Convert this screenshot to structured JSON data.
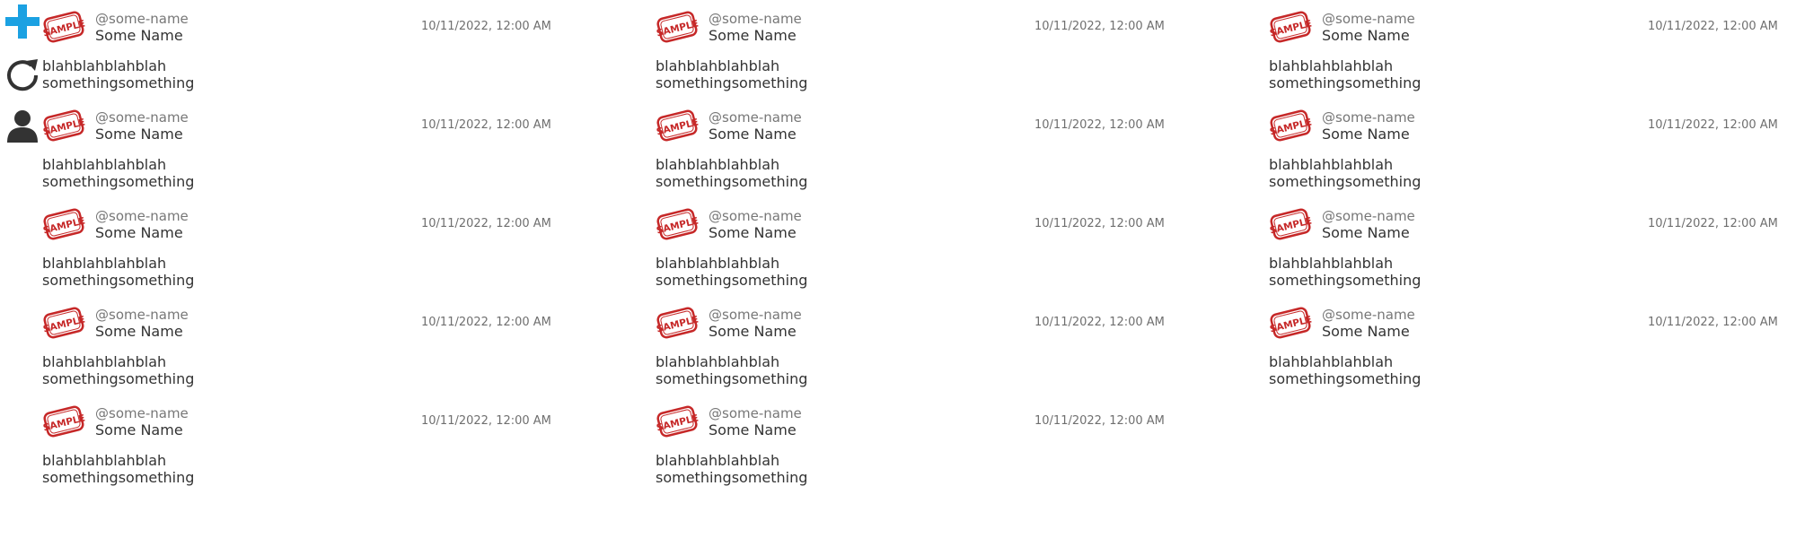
{
  "sidebar": {
    "add": {
      "icon": "plus-icon",
      "color": "#1ba1e2"
    },
    "refresh": {
      "icon": "refresh-icon",
      "color": "#333333"
    },
    "profile": {
      "icon": "user-icon",
      "color": "#333333"
    }
  },
  "avatar": {
    "stamp_text": "SAMPLE",
    "color": "#c62828"
  },
  "columns": [
    {
      "posts": [
        {
          "handle": "@some-name",
          "name": "Some Name",
          "timestamp": "10/11/2022, 12:00 AM",
          "lines": [
            "blahblahblahblah",
            "somethingsomething"
          ]
        },
        {
          "handle": "@some-name",
          "name": "Some Name",
          "timestamp": "10/11/2022, 12:00 AM",
          "lines": [
            "blahblahblahblah",
            "somethingsomething"
          ]
        },
        {
          "handle": "@some-name",
          "name": "Some Name",
          "timestamp": "10/11/2022, 12:00 AM",
          "lines": [
            "blahblahblahblah",
            "somethingsomething"
          ]
        },
        {
          "handle": "@some-name",
          "name": "Some Name",
          "timestamp": "10/11/2022, 12:00 AM",
          "lines": [
            "blahblahblahblah",
            "somethingsomething"
          ]
        },
        {
          "handle": "@some-name",
          "name": "Some Name",
          "timestamp": "10/11/2022, 12:00 AM",
          "lines": [
            "blahblahblahblah",
            "somethingsomething"
          ]
        }
      ]
    },
    {
      "posts": [
        {
          "handle": "@some-name",
          "name": "Some Name",
          "timestamp": "10/11/2022, 12:00 AM",
          "lines": [
            "blahblahblahblah",
            "somethingsomething"
          ]
        },
        {
          "handle": "@some-name",
          "name": "Some Name",
          "timestamp": "10/11/2022, 12:00 AM",
          "lines": [
            "blahblahblahblah",
            "somethingsomething"
          ]
        },
        {
          "handle": "@some-name",
          "name": "Some Name",
          "timestamp": "10/11/2022, 12:00 AM",
          "lines": [
            "blahblahblahblah",
            "somethingsomething"
          ]
        },
        {
          "handle": "@some-name",
          "name": "Some Name",
          "timestamp": "10/11/2022, 12:00 AM",
          "lines": [
            "blahblahblahblah",
            "somethingsomething"
          ]
        },
        {
          "handle": "@some-name",
          "name": "Some Name",
          "timestamp": "10/11/2022, 12:00 AM",
          "lines": [
            "blahblahblahblah",
            "somethingsomething"
          ]
        }
      ]
    },
    {
      "posts": [
        {
          "handle": "@some-name",
          "name": "Some Name",
          "timestamp": "10/11/2022, 12:00 AM",
          "lines": [
            "blahblahblahblah",
            "somethingsomething"
          ]
        },
        {
          "handle": "@some-name",
          "name": "Some Name",
          "timestamp": "10/11/2022, 12:00 AM",
          "lines": [
            "blahblahblahblah",
            "somethingsomething"
          ]
        },
        {
          "handle": "@some-name",
          "name": "Some Name",
          "timestamp": "10/11/2022, 12:00 AM",
          "lines": [
            "blahblahblahblah",
            "somethingsomething"
          ]
        },
        {
          "handle": "@some-name",
          "name": "Some Name",
          "timestamp": "10/11/2022, 12:00 AM",
          "lines": [
            "blahblahblahblah",
            "somethingsomething"
          ]
        }
      ]
    }
  ]
}
